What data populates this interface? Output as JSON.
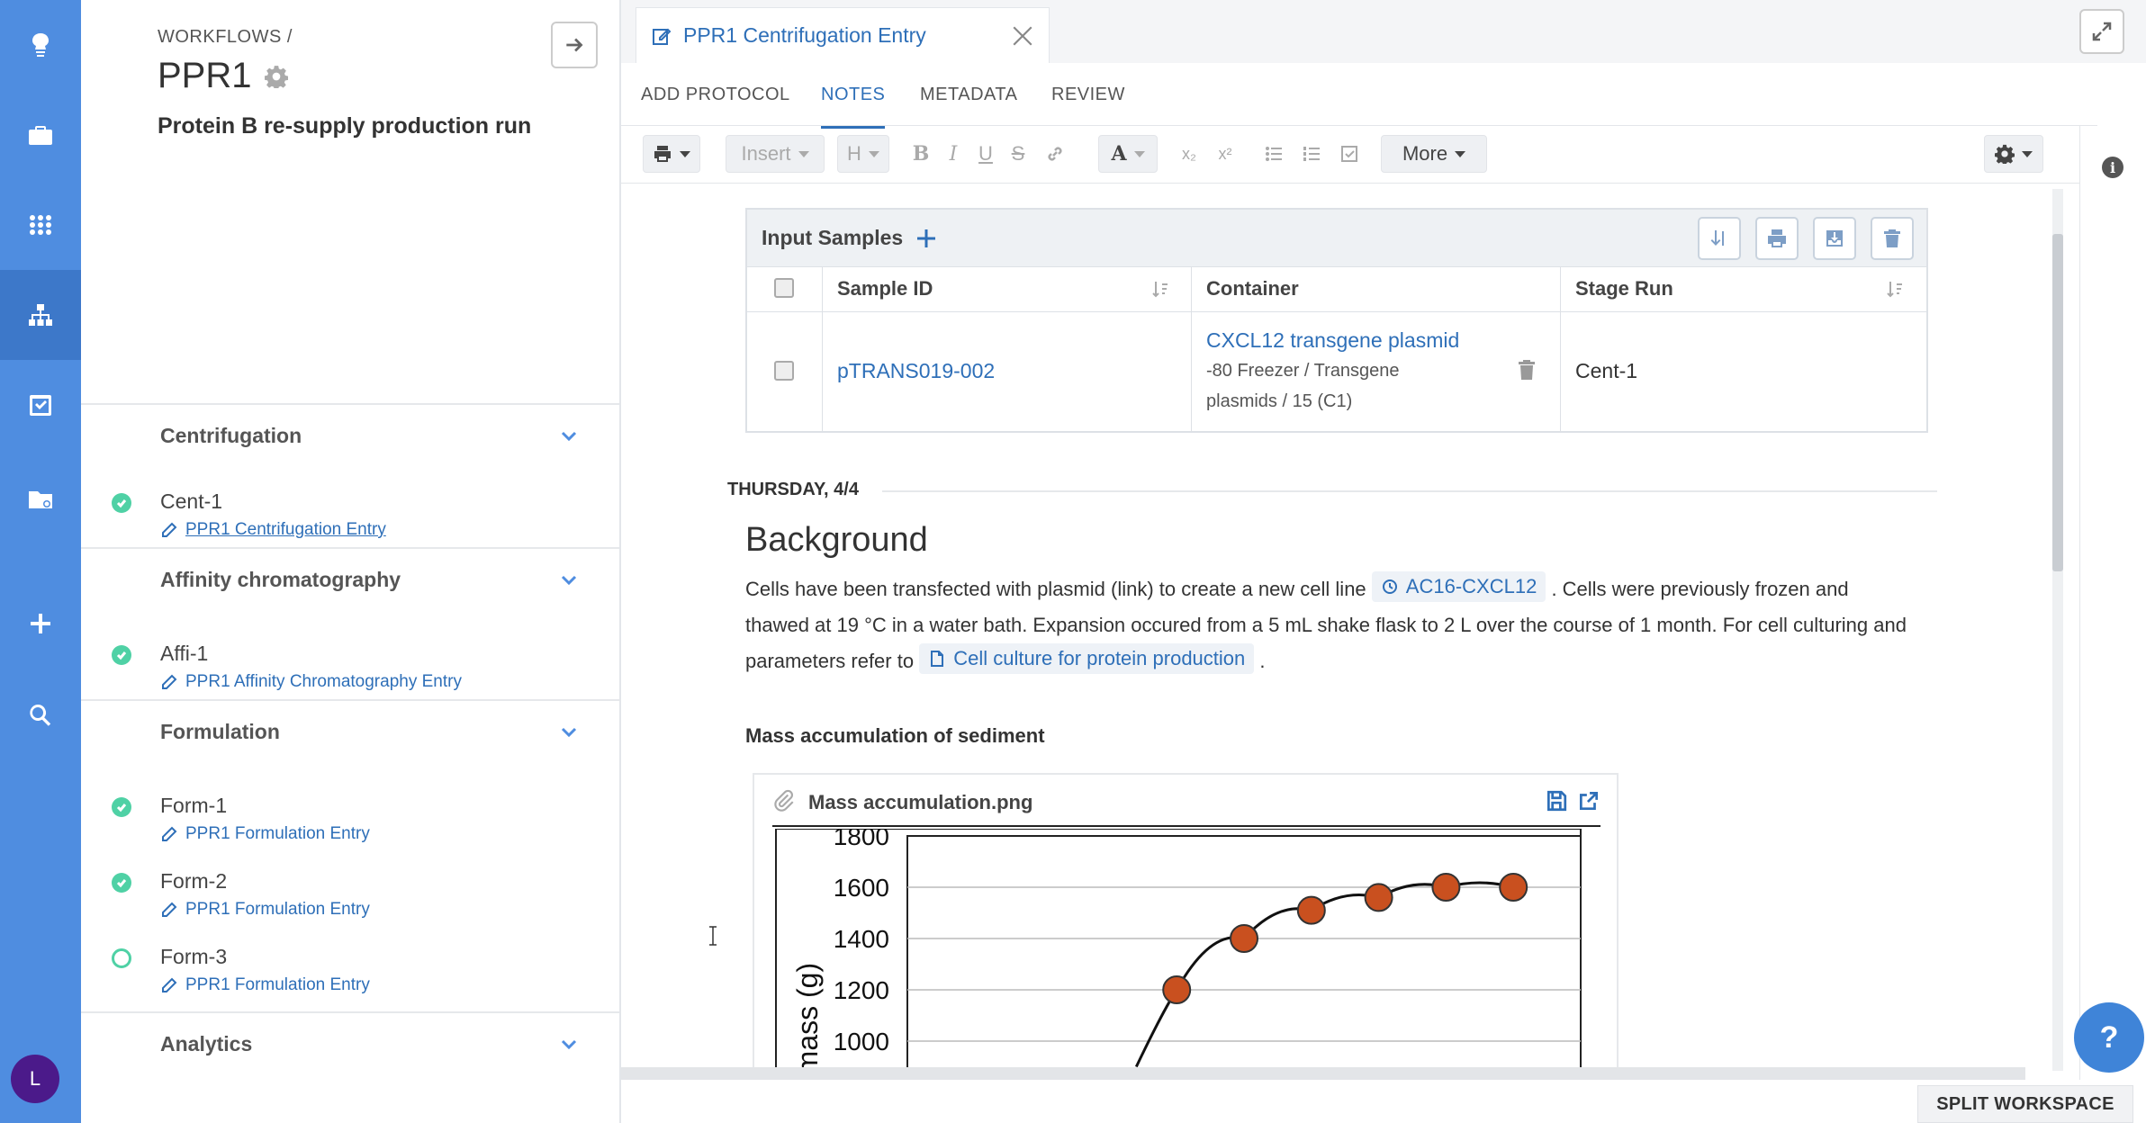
{
  "rail": {
    "avatar_letter": "L",
    "items": [
      "logo-icon",
      "briefcase-icon",
      "apps-grid-icon",
      "workflow-icon",
      "tasks-icon",
      "folder-icon",
      "add-icon",
      "search-icon"
    ],
    "active": "workflow-icon"
  },
  "workflow": {
    "breadcrumb": "WORKFLOWS /",
    "title": "PPR1",
    "subtitle": "Protein B re-supply production run",
    "sections": [
      {
        "label": "Centrifugation",
        "stages": [
          {
            "name": "Cent-1",
            "entry": "PPR1 Centrifugation Entry",
            "status": "complete"
          }
        ]
      },
      {
        "label": "Affinity chromatography",
        "stages": [
          {
            "name": "Affi-1",
            "entry": "PPR1 Affinity Chromatography Entry",
            "status": "complete"
          }
        ]
      },
      {
        "label": "Formulation",
        "stages": [
          {
            "name": "Form-1",
            "entry": "PPR1 Formulation Entry",
            "status": "complete"
          },
          {
            "name": "Form-2",
            "entry": "PPR1 Formulation Entry",
            "status": "complete"
          },
          {
            "name": "Form-3",
            "entry": "PPR1 Formulation Entry",
            "status": "open"
          }
        ]
      },
      {
        "label": "Analytics",
        "stages": []
      }
    ]
  },
  "document": {
    "tab_title": "PPR1 Centrifugation Entry",
    "nav_tabs": [
      "ADD PROTOCOL",
      "NOTES",
      "METADATA",
      "REVIEW"
    ],
    "active_tab": "NOTES",
    "toolbar": {
      "insert": "Insert",
      "heading": "H",
      "bold": "B",
      "italic": "I",
      "underline": "U",
      "strike": "S",
      "font_color": "A",
      "subscript": "x₂",
      "superscript": "x²",
      "more": "More"
    }
  },
  "samples": {
    "title": "Input Samples",
    "columns": [
      "Sample ID",
      "Container",
      "Stage Run"
    ],
    "rows": [
      {
        "sample_id": "pTRANS019-002",
        "container_name": "CXCL12 transgene plasmid",
        "container_path_1": "-80 Freezer / Transgene",
        "container_path_2": "plasmids / 15 (C1)",
        "stage_run": "Cent-1"
      }
    ]
  },
  "notes": {
    "date": "THURSDAY, 4/4",
    "heading": "Background",
    "para_1": "Cells have been transfected with plasmid (link) to create a new cell line",
    "chip_cell_line": "AC16-CXCL12",
    "para_2": ". Cells were previously frozen and thawed at 19 °C in a water bath. Expansion occured from a 5 mL shake flask to 2 L over the course of 1 month. For cell culturing and parameters refer to",
    "chip_doc": "Cell culture for protein production",
    "para_end": ".",
    "subheading": "Mass accumulation of sediment",
    "attachment": "Mass accumulation.png"
  },
  "chart_data": {
    "type": "scatter",
    "title": "",
    "xlabel": "",
    "ylabel": "d mass (g)",
    "ylim": [
      1000,
      1800
    ],
    "yticks": [
      "1800",
      "1600",
      "1400",
      "1200",
      "1000"
    ],
    "points": [
      {
        "x": 4,
        "y": 1200
      },
      {
        "x": 5,
        "y": 1400
      },
      {
        "x": 6,
        "y": 1510
      },
      {
        "x": 7,
        "y": 1560
      },
      {
        "x": 8,
        "y": 1600
      },
      {
        "x": 9,
        "y": 1600
      }
    ],
    "xlim": [
      0,
      10
    ],
    "grid": true,
    "colors": {
      "marker": "#c9501f",
      "line": "#111111"
    }
  },
  "footer": {
    "split_workspace": "SPLIT WORKSPACE",
    "help": "?"
  },
  "colors": {
    "rail": "#4f8de0",
    "accent": "#2e6fb8",
    "status_complete": "#4fd1a5",
    "avatar": "#4b1a8a"
  }
}
